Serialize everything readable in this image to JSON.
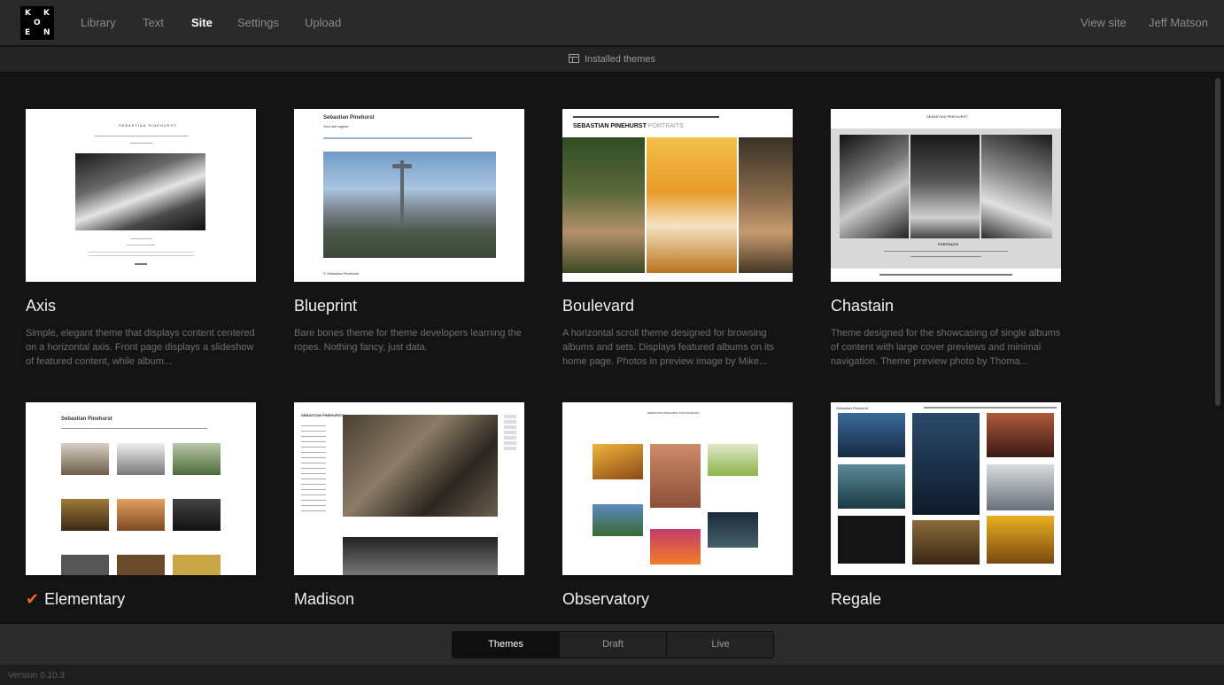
{
  "app": {
    "logo_letters": [
      "K",
      "K",
      "O",
      "E",
      "N"
    ],
    "nav": [
      "Library",
      "Text",
      "Site",
      "Settings",
      "Upload"
    ],
    "active_nav": "Site",
    "view_site": "View site",
    "user_name": "Jeff Matson"
  },
  "subbar": {
    "icon": "table-icon",
    "label": "Installed themes"
  },
  "themes": [
    {
      "name": "Axis",
      "desc": "Simple, elegant theme that displays content centered on a horizontal axis. Front page displays a slideshow of featured content, while album...",
      "active": false
    },
    {
      "name": "Blueprint",
      "desc": "Bare bones theme for theme developers learning the ropes. Nothing fancy, just data.",
      "active": false
    },
    {
      "name": "Boulevard",
      "desc": "A horizontal scroll theme designed for browsing albums and sets. Displays featured albums on its home page. Photos in preview image by Mike...",
      "active": false
    },
    {
      "name": "Chastain",
      "desc": "Theme designed for the showcasing of single albums of content with large cover previews and minimal navigation. Theme preview photo by Thoma...",
      "active": false
    },
    {
      "name": "Elementary",
      "desc": "",
      "active": true,
      "active_icon": "checkmark-icon"
    },
    {
      "name": "Madison",
      "desc": "",
      "active": false
    },
    {
      "name": "Observatory",
      "desc": "",
      "active": false
    },
    {
      "name": "Regale",
      "desc": "",
      "active": false
    }
  ],
  "thumb_text": {
    "axis_site": "SEBASTIAN PINEHURST",
    "blueprint_title": "Sebastian Pinehurst",
    "blueprint_tagline": "Your site tagline",
    "blueprint_footer": "© Sebastian Pinehurst",
    "boulevard_site": "SEBASTIAN PINEHURST",
    "boulevard_section": "/ PORTRAITS",
    "chastain_site": "SEBASTIAN PINEHURST",
    "chastain_caption": "PORTRAITS",
    "elementary_site": "Sebastian Pinehurst",
    "madison_site": "SEBASTIAN PINEHURST",
    "observatory_site": "SEBASTIAN PINEHURST PHOTOGRAPHY",
    "regale_site": "Sebastian Pinehurst"
  },
  "bottom_tabs": [
    "Themes",
    "Draft",
    "Live"
  ],
  "active_tab": "Themes",
  "version": "Version 0.10.3",
  "colors": {
    "accent": "#e8672a",
    "background": "#141414",
    "topbar": "#2a2a2a"
  }
}
